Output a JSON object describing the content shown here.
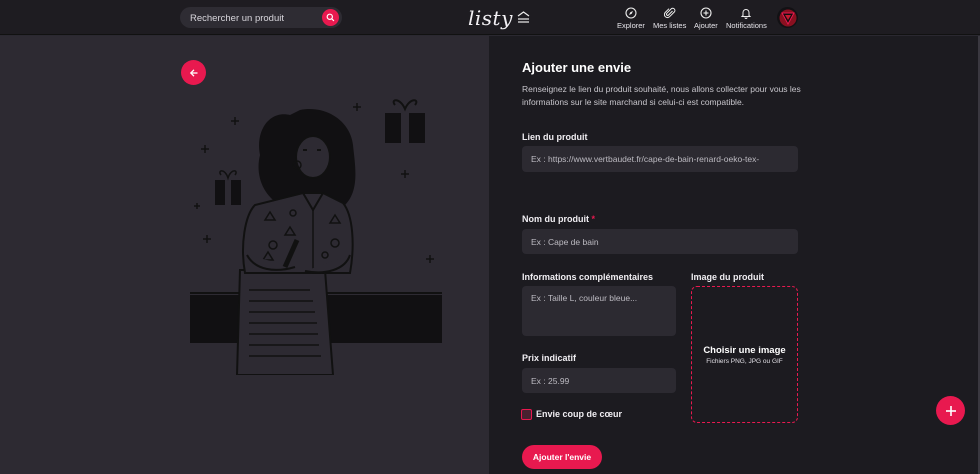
{
  "header": {
    "search_placeholder": "Rechercher un produit",
    "logo_text": "listy",
    "nav": [
      {
        "label": "Explorer",
        "icon": "compass-icon"
      },
      {
        "label": "Mes listes",
        "icon": "paperclip-icon"
      },
      {
        "label": "Ajouter",
        "icon": "plus-circle-icon"
      },
      {
        "label": "Notifications",
        "icon": "bell-icon"
      }
    ]
  },
  "form": {
    "title": "Ajouter une envie",
    "description": "Renseignez le lien du produit souhaité, nous allons collecter pour vous les informations sur le site marchand si celui-ci est compatible.",
    "link_label": "Lien du produit",
    "link_placeholder": "Ex : https://www.vertbaudet.fr/cape-de-bain-renard-oeko-tex-",
    "name_label": "Nom du produit",
    "name_required": "*",
    "name_placeholder": "Ex : Cape de bain",
    "info_label": "Informations complémentaires",
    "info_placeholder": "Ex : Taille L, couleur bleue...",
    "image_label": "Image du produit",
    "image_cta": "Choisir une image",
    "image_formats": "Fichiers PNG, JPG ou GIF",
    "price_label": "Prix indicatif",
    "price_placeholder": "Ex : 25.99",
    "favorite_label": "Envie coup de cœur",
    "submit_label": "Ajouter l'envie"
  },
  "colors": {
    "accent": "#e8194f",
    "panel_dark": "#1c1b20",
    "panel_left": "#2d2a32"
  }
}
